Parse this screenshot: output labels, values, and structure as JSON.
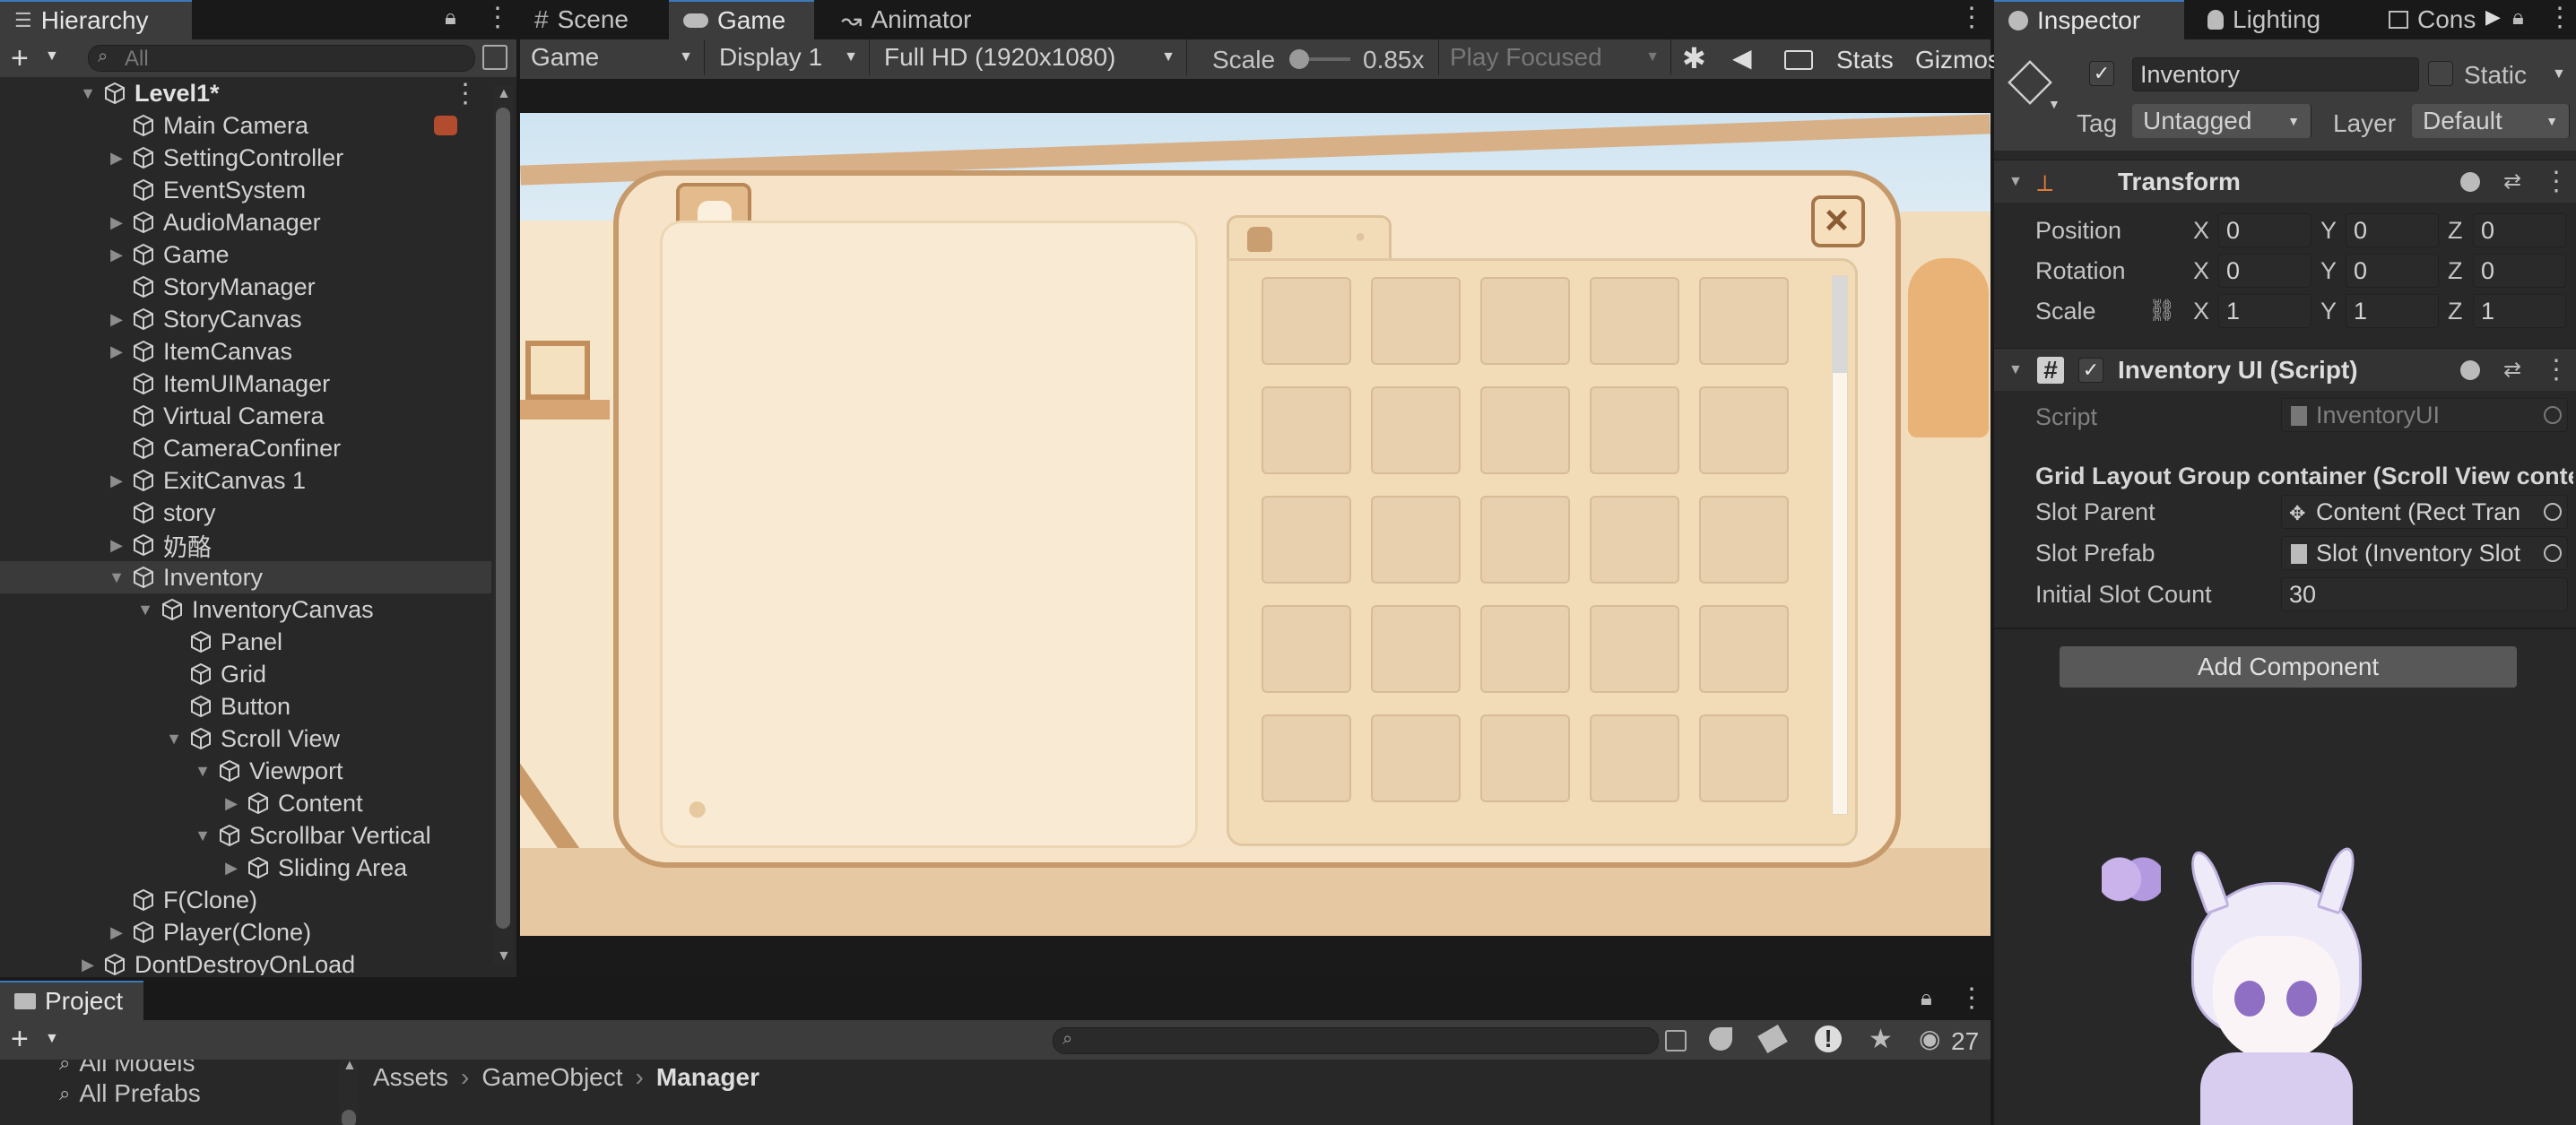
{
  "hierarchy": {
    "tab_label": "Hierarchy",
    "search_placeholder": "All",
    "items": [
      {
        "label": "Level1*",
        "arrow": "down",
        "icon": "unity-scene-icon",
        "bold": true
      },
      {
        "label": "Main Camera",
        "arrow": "none"
      },
      {
        "label": "SettingController",
        "arrow": "right"
      },
      {
        "label": "EventSystem",
        "arrow": "none"
      },
      {
        "label": "AudioManager",
        "arrow": "right"
      },
      {
        "label": "Game",
        "arrow": "right"
      },
      {
        "label": "StoryManager",
        "arrow": "none"
      },
      {
        "label": "StoryCanvas",
        "arrow": "right"
      },
      {
        "label": "ItemCanvas",
        "arrow": "right"
      },
      {
        "label": "ItemUIManager",
        "arrow": "none"
      },
      {
        "label": "Virtual Camera",
        "arrow": "none"
      },
      {
        "label": "CameraConfiner",
        "arrow": "none"
      },
      {
        "label": "ExitCanvas 1",
        "arrow": "right"
      },
      {
        "label": "story",
        "arrow": "none"
      },
      {
        "label": "奶酪",
        "arrow": "right"
      },
      {
        "label": "Inventory",
        "arrow": "down",
        "selected": true
      },
      {
        "label": "InventoryCanvas",
        "arrow": "down"
      },
      {
        "label": "Panel",
        "arrow": "none"
      },
      {
        "label": "Grid",
        "arrow": "none"
      },
      {
        "label": "Button",
        "arrow": "none"
      },
      {
        "label": "Scroll View",
        "arrow": "down"
      },
      {
        "label": "Viewport",
        "arrow": "down"
      },
      {
        "label": "Content",
        "arrow": "right"
      },
      {
        "label": "Scrollbar Vertical",
        "arrow": "down"
      },
      {
        "label": "Sliding Area",
        "arrow": "right"
      },
      {
        "label": "F(Clone)",
        "arrow": "none"
      },
      {
        "label": "Player(Clone)",
        "arrow": "right"
      },
      {
        "label": "DontDestroyOnLoad",
        "arrow": "right"
      }
    ]
  },
  "center_tabs": {
    "scene": "Scene",
    "game": "Game",
    "animator": "Animator"
  },
  "game_toolbar": {
    "view_mode": "Game",
    "display": "Display 1",
    "resolution": "Full HD (1920x1080)",
    "scale_label": "Scale",
    "scale_value": "0.85x",
    "play_mode": "Play Focused",
    "stats": "Stats",
    "gizmos": "Gizmos"
  },
  "game_view": {
    "slot_count": 25,
    "colors": {
      "panel_bg": "#f7e4c8",
      "slot": "#e8cfae",
      "frame": "#c79a6b"
    }
  },
  "inspector": {
    "tabs": {
      "inspector": "Inspector",
      "lighting": "Lighting",
      "console": "Cons"
    },
    "object_name": "Inventory",
    "static_label": "Static",
    "tag_label": "Tag",
    "tag_value": "Untagged",
    "layer_label": "Layer",
    "layer_value": "Default",
    "transform": {
      "title": "Transform",
      "position_label": "Position",
      "rotation_label": "Rotation",
      "scale_label": "Scale",
      "position": {
        "x": "0",
        "y": "0",
        "z": "0"
      },
      "rotation": {
        "x": "0",
        "y": "0",
        "z": "0"
      },
      "scale": {
        "x": "1",
        "y": "1",
        "z": "1"
      }
    },
    "script_component": {
      "title": "Inventory UI (Script)",
      "script_label": "Script",
      "script_value": "InventoryUI",
      "header": "Grid Layout Group container (Scroll View conte",
      "slot_parent_label": "Slot Parent",
      "slot_parent_value": "Content (Rect Tran",
      "slot_prefab_label": "Slot Prefab",
      "slot_prefab_value": "Slot (Inventory Slot",
      "initial_slot_label": "Initial Slot Count",
      "initial_slot_value": "30"
    },
    "add_component": "Add Component"
  },
  "project": {
    "tab_label": "Project",
    "count": "27",
    "sidebar": [
      "All Models",
      "All Prefabs"
    ],
    "breadcrumb": [
      "Assets",
      "GameObject",
      "Manager"
    ]
  }
}
